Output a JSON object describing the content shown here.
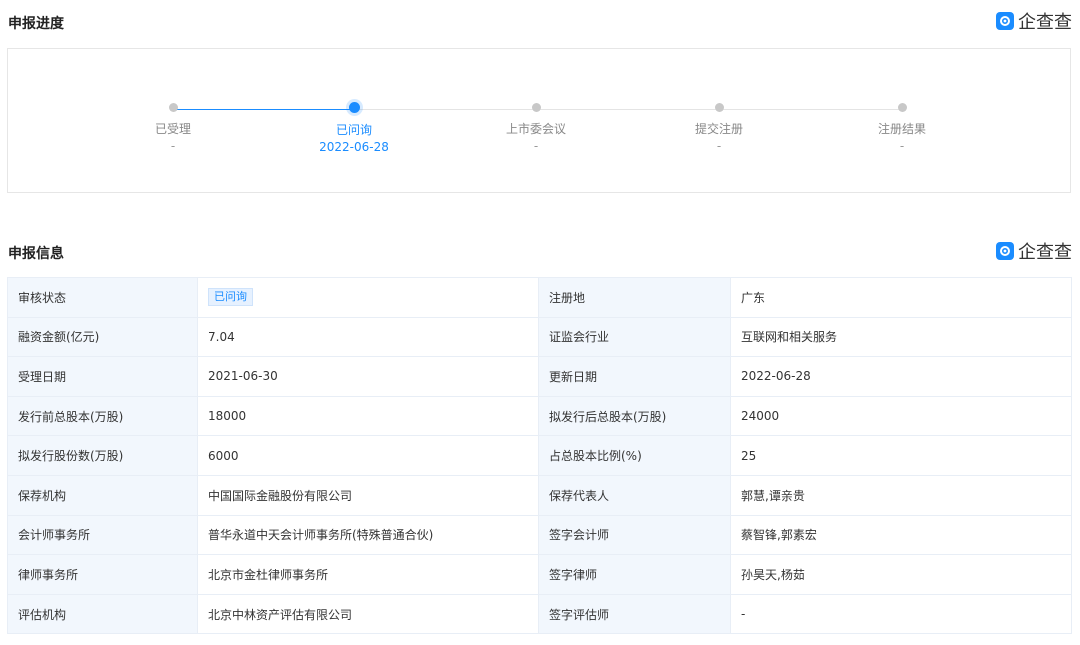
{
  "brand": {
    "name": "企查查",
    "accent": "#1a8cff"
  },
  "progress": {
    "title": "申报进度",
    "current_step_index": 1,
    "steps": [
      {
        "label": "已受理",
        "date": "-"
      },
      {
        "label": "已问询",
        "date": "2022-06-28"
      },
      {
        "label": "上市委会议",
        "date": "-"
      },
      {
        "label": "提交注册",
        "date": "-"
      },
      {
        "label": "注册结果",
        "date": "-"
      }
    ]
  },
  "info": {
    "title": "申报信息",
    "rows": [
      {
        "l1": "审核状态",
        "v1": "已问询",
        "l2": "注册地",
        "v2": "广东"
      },
      {
        "l1": "融资金额(亿元)",
        "v1": "7.04",
        "l2": "证监会行业",
        "v2": "互联网和相关服务"
      },
      {
        "l1": "受理日期",
        "v1": "2021-06-30",
        "l2": "更新日期",
        "v2": "2022-06-28"
      },
      {
        "l1": "发行前总股本(万股)",
        "v1": "18000",
        "l2": "拟发行后总股本(万股)",
        "v2": "24000"
      },
      {
        "l1": "拟发行股份数(万股)",
        "v1": "6000",
        "l2": "占总股本比例(%)",
        "v2": "25"
      },
      {
        "l1": "保荐机构",
        "v1": "中国国际金融股份有限公司",
        "l2": "保荐代表人",
        "v2": "郭慧,谭亲贵"
      },
      {
        "l1": "会计师事务所",
        "v1": "普华永道中天会计师事务所(特殊普通合伙)",
        "l2": "签字会计师",
        "v2": "蔡智锋,郭素宏"
      },
      {
        "l1": "律师事务所",
        "v1": "北京市金杜律师事务所",
        "l2": "签字律师",
        "v2": "孙昊天,杨茹"
      },
      {
        "l1": "评估机构",
        "v1": "北京中林资产评估有限公司",
        "l2": "签字评估师",
        "v2": "-"
      }
    ]
  }
}
